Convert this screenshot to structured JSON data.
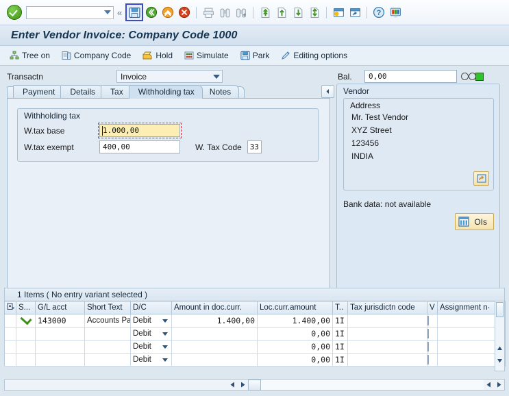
{
  "system_toolbar": {
    "status_icon": "green-check-icon",
    "command_field_value": "",
    "buttons": [
      {
        "name": "save-button",
        "icon": "save-disk-icon",
        "selected": true
      },
      {
        "name": "back-button",
        "icon": "green-back-arrow-icon"
      },
      {
        "name": "exit-button",
        "icon": "orange-up-arrow-icon"
      },
      {
        "name": "cancel-button",
        "icon": "red-cancel-icon"
      },
      {
        "name": "print-button",
        "icon": "printer-icon"
      },
      {
        "name": "find-button",
        "icon": "binoculars-icon"
      },
      {
        "name": "find-next-button",
        "icon": "binoculars-plus-icon"
      },
      {
        "name": "first-page-button",
        "icon": "first-page-icon"
      },
      {
        "name": "previous-page-button",
        "icon": "previous-page-icon"
      },
      {
        "name": "next-page-button",
        "icon": "next-page-icon"
      },
      {
        "name": "last-page-button",
        "icon": "last-page-icon"
      },
      {
        "name": "create-session-button",
        "icon": "new-session-icon"
      },
      {
        "name": "create-shortcut-button",
        "icon": "shortcut-icon"
      },
      {
        "name": "help-button",
        "icon": "question-help-icon"
      },
      {
        "name": "customize-layout-button",
        "icon": "layout-monitor-icon"
      }
    ]
  },
  "title": "Enter Vendor Invoice: Company Code 1000",
  "app_toolbar": [
    {
      "label": "Tree on",
      "icon": "tree-icon"
    },
    {
      "label": "Company Code",
      "icon": "company-code-icon"
    },
    {
      "label": "Hold",
      "icon": "hold-icon"
    },
    {
      "label": "Simulate",
      "icon": "simulate-icon"
    },
    {
      "label": "Park",
      "icon": "park-disk-icon"
    },
    {
      "label": "Editing options",
      "icon": "pencil-icon"
    }
  ],
  "transaction": {
    "label": "Transactn",
    "selected": "Invoice"
  },
  "tabs": [
    {
      "label": "Payment",
      "active": false
    },
    {
      "label": "Details",
      "active": false
    },
    {
      "label": "Tax",
      "active": false
    },
    {
      "label": "Withholding tax",
      "active": true
    },
    {
      "label": "Notes",
      "active": false
    }
  ],
  "tab_nav": {
    "prev": "◄",
    "next": "►",
    "list": "tab-list-icon"
  },
  "withholding": {
    "group_title": "Withholding tax",
    "base_label": "W.tax base",
    "base_value": "1.000,00",
    "exempt_label": "W.tax exempt",
    "exempt_value": "400,00",
    "code_label": "W. Tax Code",
    "code_value": "33"
  },
  "balance": {
    "label": "Bal.",
    "value": "0,00",
    "indicator_color": "#2fc42f"
  },
  "vendor": {
    "title": "Vendor",
    "address_title": "Address",
    "address_lines": [
      "Mr. Test Vendor",
      "XYZ Street",
      "123456",
      "INDIA"
    ],
    "address_button_icon": "address-details-icon",
    "bank_data": "Bank data: not available",
    "ois_label": "OIs",
    "ois_icon": "open-items-icon"
  },
  "items": {
    "header": "1 Items ( No entry variant selected )",
    "columns": [
      {
        "name": "row-select-icon",
        "label": ""
      },
      {
        "name": "status",
        "label": "S..."
      },
      {
        "name": "gl-acct",
        "label": "G/L acct"
      },
      {
        "name": "short-text",
        "label": "Short Text"
      },
      {
        "name": "dc",
        "label": "D/C"
      },
      {
        "name": "amount-doc-curr",
        "label": "Amount in doc.curr."
      },
      {
        "name": "loc-curr-amount",
        "label": "Loc.curr.amount"
      },
      {
        "name": "tax-code",
        "label": "T.."
      },
      {
        "name": "tax-jurisdictn-code",
        "label": "Tax jurisdictn code"
      },
      {
        "name": "v",
        "label": "V"
      },
      {
        "name": "assignment-number",
        "label": "Assignment n·"
      }
    ],
    "rows": [
      {
        "status": "ok",
        "gl_acct": "143000",
        "short_text": "Accounts Pa..",
        "dc": "Debit",
        "amount_doc_curr": "1.400,00",
        "loc_curr_amount": "1.400,00",
        "tax_code": "1I",
        "tax_jurisdictn_code": "",
        "v": false,
        "assignment": ""
      },
      {
        "status": "empty",
        "gl_acct": "",
        "short_text": "",
        "dc": "Debit",
        "amount_doc_curr": "",
        "loc_curr_amount": "0,00",
        "tax_code": "1I",
        "tax_jurisdictn_code": "",
        "v": false,
        "assignment": ""
      },
      {
        "status": "empty",
        "gl_acct": "",
        "short_text": "",
        "dc": "Debit",
        "amount_doc_curr": "",
        "loc_curr_amount": "0,00",
        "tax_code": "1I",
        "tax_jurisdictn_code": "",
        "v": false,
        "assignment": ""
      },
      {
        "status": "empty",
        "gl_acct": "",
        "short_text": "",
        "dc": "Debit",
        "amount_doc_curr": "",
        "loc_curr_amount": "0,00",
        "tax_code": "1I",
        "tax_jurisdictn_code": "",
        "v": false,
        "assignment": ""
      }
    ]
  }
}
